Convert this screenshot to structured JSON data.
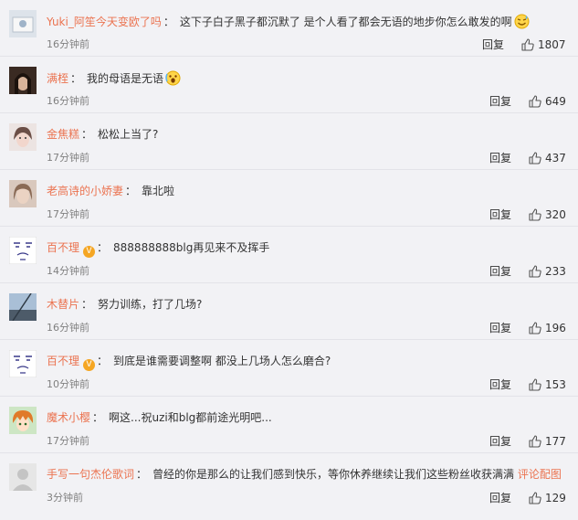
{
  "comments": [
    {
      "name": "Yuki_阿笙今天变欧了吗",
      "text": "这下子白子黑子都沉默了 是个人看了都会无语的地步你怎么敢发的啊",
      "time": "16分钟前",
      "reply": "回复",
      "likes": "1807",
      "verified": false,
      "emoji": "sweat-smile-emoji",
      "link": ""
    },
    {
      "name": "满桎",
      "text": "我的母语是无语",
      "time": "16分钟前",
      "reply": "回复",
      "likes": "649",
      "verified": false,
      "emoji": "scream-emoji",
      "link": ""
    },
    {
      "name": "金焦糕",
      "text": "松松上当了?",
      "time": "17分钟前",
      "reply": "回复",
      "likes": "437",
      "verified": false,
      "emoji": "",
      "link": ""
    },
    {
      "name": "老高诗的小娇妻",
      "text": "靠北啦",
      "time": "17分钟前",
      "reply": "回复",
      "likes": "320",
      "verified": false,
      "emoji": "",
      "link": ""
    },
    {
      "name": "百不理",
      "text": "888888888blg再见来不及挥手",
      "time": "14分钟前",
      "reply": "回复",
      "likes": "233",
      "verified": true,
      "emoji": "",
      "link": ""
    },
    {
      "name": "木替片",
      "text": "努力训练，打了几场?",
      "time": "16分钟前",
      "reply": "回复",
      "likes": "196",
      "verified": false,
      "emoji": "",
      "link": ""
    },
    {
      "name": "百不理",
      "text": "到底是谁需要调整啊 都没上几场人怎么磨合?",
      "time": "10分钟前",
      "reply": "回复",
      "likes": "153",
      "verified": true,
      "emoji": "",
      "link": ""
    },
    {
      "name": "魔术小樱",
      "text": "啊这...祝uzi和blg都前途光明吧...",
      "time": "17分钟前",
      "reply": "回复",
      "likes": "177",
      "verified": false,
      "emoji": "",
      "link": ""
    },
    {
      "name": "手写一句杰伦歌词",
      "text": "曾经的你是那么的让我们感到快乐，等你休养继续让我们这些粉丝收获满满",
      "time": "3分钟前",
      "reply": "回复",
      "likes": "129",
      "verified": false,
      "emoji": "",
      "link": "评论配图"
    }
  ],
  "colors": {
    "name": "#eb7350",
    "text": "#333333",
    "time": "#808080",
    "background": "#f2f2f5",
    "badge": "#f5a623"
  }
}
